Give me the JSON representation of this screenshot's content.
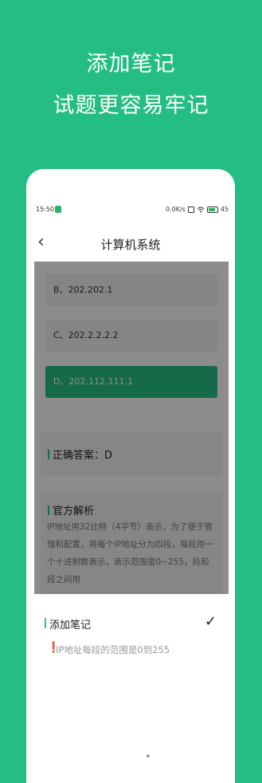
{
  "promo": {
    "line1": "添加笔记",
    "line2": "试题更容易牢记"
  },
  "status_bar": {
    "time": "15:50",
    "speed": "0.0K/s",
    "battery": "45"
  },
  "header": {
    "back_icon": "‹",
    "title": "计算机系统"
  },
  "question": {
    "options": [
      {
        "label": "B、202.202.1"
      },
      {
        "label": "C、202.2.2.2.2"
      },
      {
        "label": "D、202.112.111.1"
      }
    ]
  },
  "answer": {
    "label": "正确答案：D"
  },
  "explanation": {
    "title": "官方解析",
    "text": "IP地址用32比特（4字节）表示，为了便于管理和配置，将每个IP地址分为四段，每段用一个十进制数表示，表示范围是0~255，段和段之间用"
  },
  "note_sheet": {
    "title": "添加笔记",
    "confirm_icon": "✓",
    "warning_icon": "❗",
    "note_text": "IP地址每段的范围是0到255"
  },
  "colors": {
    "brand": "#24bd83",
    "selected_option": "#27c287"
  }
}
